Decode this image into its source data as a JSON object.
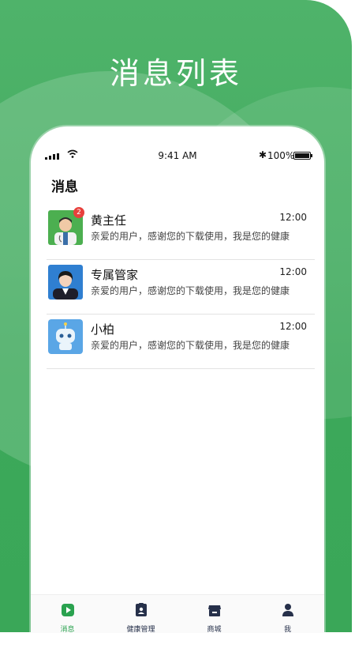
{
  "hero": {
    "title": "消息列表"
  },
  "status_bar": {
    "time": "9:41 AM",
    "battery": "100%"
  },
  "page": {
    "title": "消息"
  },
  "conversations": [
    {
      "name": "黄主任",
      "time": "12:00",
      "preview": "亲爱的用户，感谢您的下载使用，我是您的健康",
      "badge": "2",
      "avatar": "doctor-avatar"
    },
    {
      "name": "专属管家",
      "time": "12:00",
      "preview": "亲爱的用户，感谢您的下载使用，我是您的健康",
      "badge": "",
      "avatar": "butler-avatar"
    },
    {
      "name": "小柏",
      "time": "12:00",
      "preview": "亲爱的用户，感谢您的下载使用，我是您的健康",
      "badge": "",
      "avatar": "robot-avatar"
    }
  ],
  "tabbar": {
    "items": [
      {
        "label": "消息",
        "icon": "message-play-icon",
        "active": true
      },
      {
        "label": "健康管理",
        "icon": "health-badge-icon",
        "active": false
      },
      {
        "label": "商城",
        "icon": "store-icon",
        "active": false
      },
      {
        "label": "我",
        "icon": "user-icon",
        "active": false
      }
    ]
  },
  "colors": {
    "brand_green": "#3aa758",
    "active_tab": "#2aa24f",
    "badge_red": "#e8403c",
    "tab_icon": "#26304a"
  }
}
